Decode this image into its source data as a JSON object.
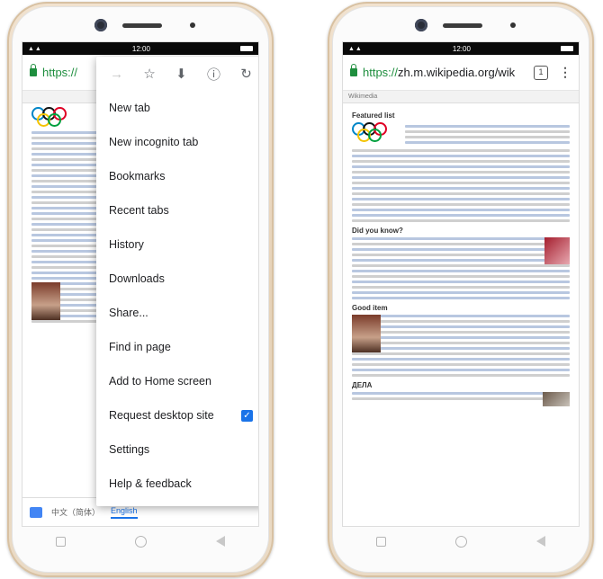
{
  "status_time": "12:00",
  "left_phone": {
    "url_prefix": "https://",
    "menu": {
      "icon_row": [
        "→",
        "☆",
        "⬇",
        "ⓘ",
        "↻"
      ],
      "items": [
        "New tab",
        "New incognito tab",
        "Bookmarks",
        "Recent tabs",
        "History",
        "Downloads",
        "Share...",
        "Find in page",
        "Add to Home screen",
        "Request desktop site",
        "Settings",
        "Help & feedback"
      ],
      "request_desktop_checked": "✓"
    },
    "translate_bar": {
      "lang1": "中文（简体）",
      "lang2": "English"
    }
  },
  "right_phone": {
    "url_scheme": "https://",
    "url_host": "zh.m.wikipedia.org/wik",
    "tab_count": "1",
    "wiki_tab": "Wikimedia",
    "sections": [
      "Featured list",
      "Did you know?",
      "Good item",
      "ДЕЛА"
    ]
  },
  "colors": {
    "accent": "#1a73e8",
    "secure": "#1e8e3e",
    "phone_gold": "#e6d2b8"
  }
}
